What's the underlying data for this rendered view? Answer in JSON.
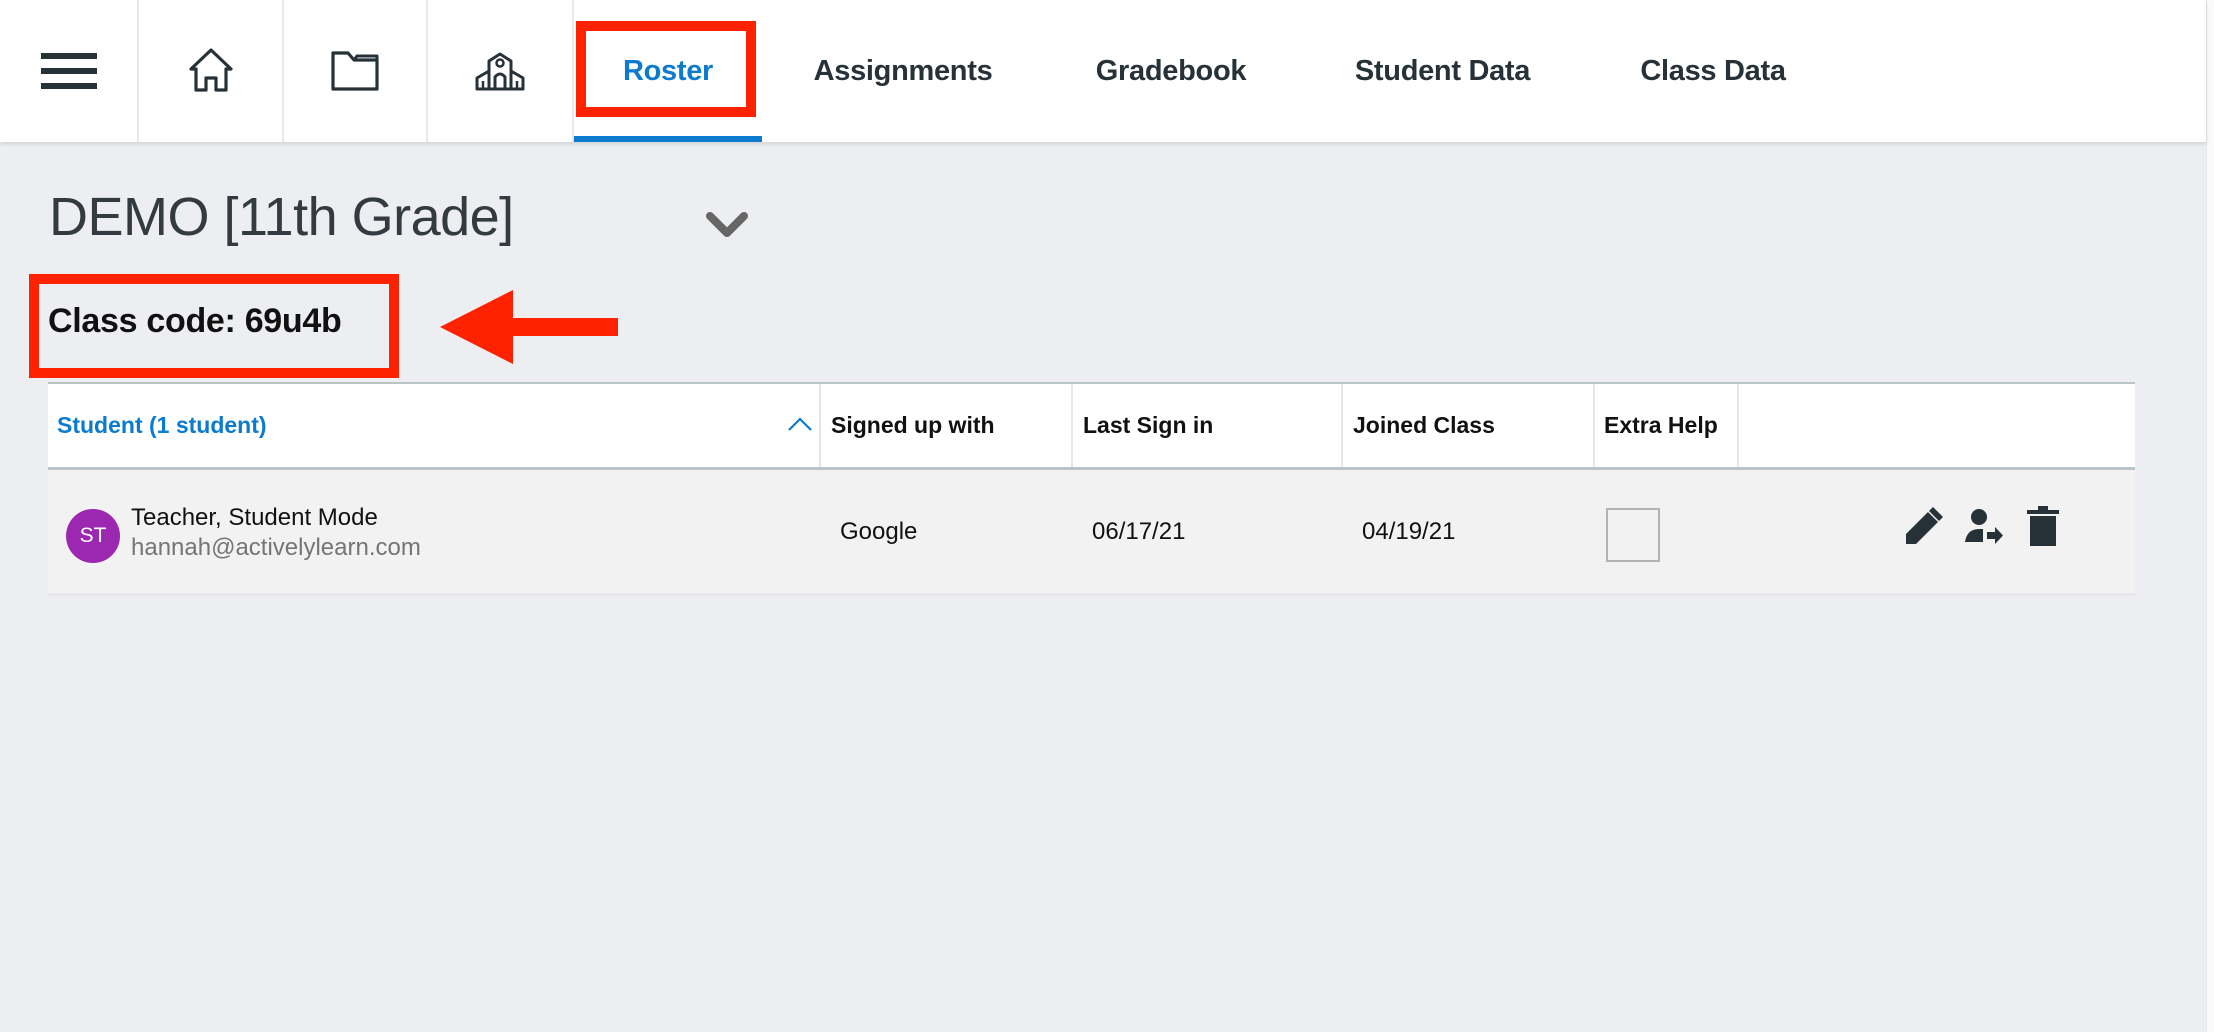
{
  "nav": {
    "icons": [
      {
        "name": "menu",
        "icon": "hamburger-icon"
      },
      {
        "name": "home",
        "icon": "home-icon"
      },
      {
        "name": "library",
        "icon": "folder-icon"
      },
      {
        "name": "school",
        "icon": "school-icon"
      }
    ],
    "tabs": [
      {
        "label": "Roster",
        "active": true
      },
      {
        "label": "Assignments",
        "active": false
      },
      {
        "label": "Gradebook",
        "active": false
      },
      {
        "label": "Student Data",
        "active": false
      },
      {
        "label": "Class Data",
        "active": false
      }
    ]
  },
  "class": {
    "title": "DEMO [11th Grade]",
    "code_label": "Class code: 69u4b"
  },
  "roster": {
    "columns": [
      {
        "label": "Student (1 student)",
        "sorted": "ascending"
      },
      {
        "label": "Signed up with"
      },
      {
        "label": "Last Sign in"
      },
      {
        "label": "Joined Class"
      },
      {
        "label": "Extra Help"
      },
      {
        "label": ""
      }
    ],
    "rows": [
      {
        "initials": "ST",
        "name": "Teacher, Student Mode",
        "email": "hannah@activelylearn.com",
        "signed_up_with": "Google",
        "last_sign_in": "06/17/21",
        "joined_class": "04/19/21",
        "extra_help": false,
        "actions": [
          "edit-icon",
          "move-student-icon",
          "delete-icon"
        ]
      }
    ]
  },
  "colors": {
    "accent": "#0b7bcf",
    "annotation": "#ff2200",
    "avatar": "#9c27b0",
    "icon": "#263238"
  }
}
